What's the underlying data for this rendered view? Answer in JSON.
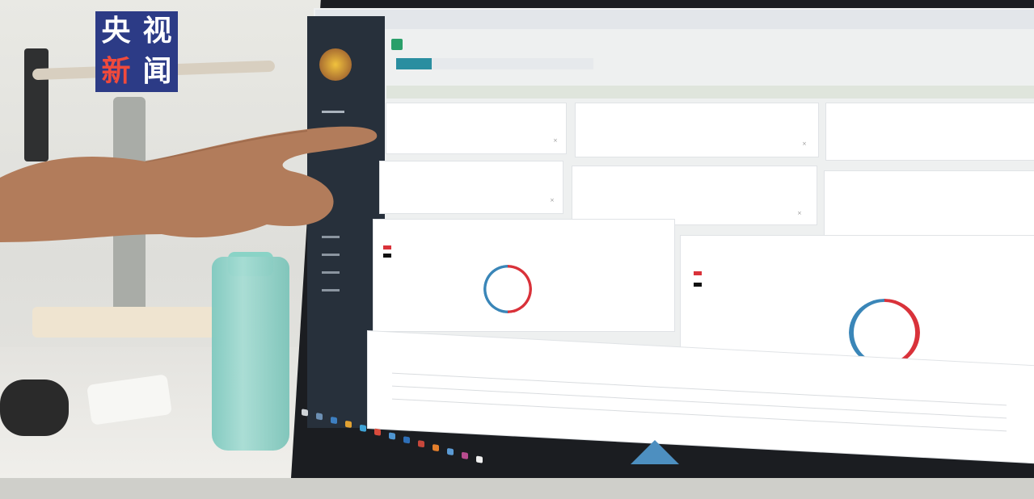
{
  "watermark": {
    "line1_a": "央",
    "line1_b": "视",
    "line2_a": "新",
    "line2_b": "闻"
  },
  "colors": {
    "logo_bg": "#2c3b86",
    "logo_red": "#f04a3c",
    "sidebar_bg": "#27303b",
    "accent_tab": "#2a8ea0",
    "donut_red": "#d9323a",
    "donut_blue": "#3a86b8"
  },
  "app": {
    "tabs": [
      "",
      "",
      "",
      "",
      "",
      ""
    ],
    "breadcrumb": "",
    "cards": [
      {
        "title": "",
        "value": ""
      },
      {
        "title": "",
        "value": ""
      },
      {
        "title": "",
        "value": ""
      },
      {
        "title": "",
        "value": ""
      },
      {
        "title": "",
        "value": ""
      },
      {
        "title": "",
        "value": ""
      }
    ],
    "charts": [
      {
        "label": "",
        "red_share": 0.5,
        "blue_share": 0.5
      },
      {
        "label": "",
        "red_share": 0.5,
        "blue_share": 0.5
      }
    ]
  },
  "icons": [
    "close-icon",
    "avatar",
    "start-icon"
  ]
}
